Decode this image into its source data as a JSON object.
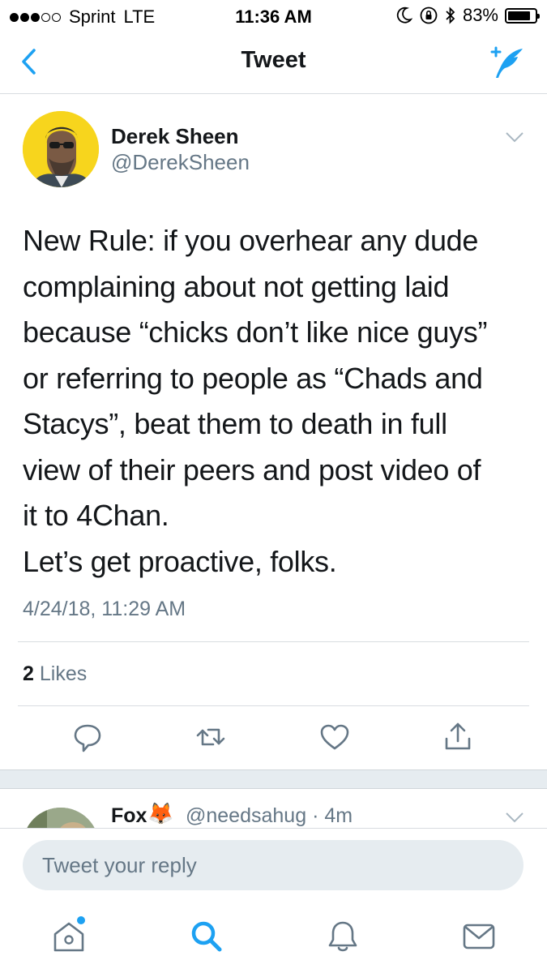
{
  "status_bar": {
    "carrier": "Sprint",
    "network": "LTE",
    "time": "11:36 AM",
    "battery_percent": "83%",
    "battery_level": 0.83,
    "signal_bars_filled": 3,
    "signal_bars_total": 5
  },
  "nav": {
    "title": "Tweet",
    "back_icon": "chevron-left-icon",
    "compose_icon": "compose-tweet-icon"
  },
  "tweet": {
    "author_name": "Derek Sheen",
    "author_handle": "@DerekSheen",
    "text": "New Rule: if you overhear any dude\ncomplaining about not getting laid\nbecause “chicks don’t like nice guys”\nor referring to people as “Chads and\nStacys”, beat them to death in full\nview of their peers and post video of\nit to 4Chan.\nLet’s get proactive, folks.",
    "timestamp": "4/24/18, 11:29 AM",
    "likes_count": "2",
    "likes_label": "Likes"
  },
  "reply_preview": {
    "name": "Fox",
    "emoji": "🦊",
    "handle": "@needsahug",
    "separator": "·",
    "age": "4m"
  },
  "reply_box": {
    "placeholder": "Tweet your reply"
  },
  "tabbar": {
    "items": [
      "home-icon",
      "search-icon",
      "notifications-icon",
      "messages-icon"
    ]
  },
  "colors": {
    "accent": "#1da1f2",
    "secondary_text": "#657786",
    "avatar_bg": "#f7d51d"
  }
}
